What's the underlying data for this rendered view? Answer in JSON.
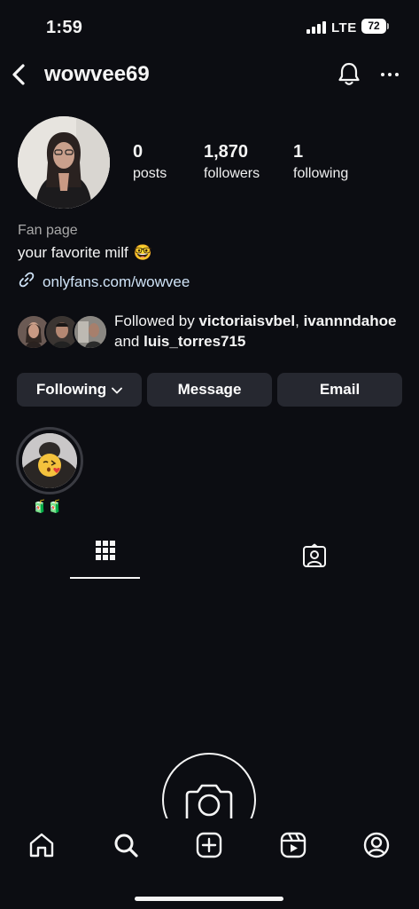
{
  "status_bar": {
    "time": "1:59",
    "network": "LTE",
    "battery": "72"
  },
  "header": {
    "username": "wowvee69",
    "icons": [
      "back-icon",
      "bell-icon",
      "more-icon"
    ]
  },
  "profile": {
    "stats": [
      {
        "value": "0",
        "label": "posts"
      },
      {
        "value": "1,870",
        "label": "followers"
      },
      {
        "value": "1",
        "label": "following"
      }
    ],
    "category": "Fan page",
    "bio": "your favorite milf",
    "bio_emoji": "🤓",
    "link": "onlyfans.com/wowvee"
  },
  "followed_by": {
    "prefix": "Followed by ",
    "user1": "victoriaisvbel",
    "sep1": ",",
    "user2": "ivannndahoe",
    "and": " and ",
    "user3": "luis_torres715"
  },
  "actions": {
    "following": "Following",
    "message": "Message",
    "email": "Email"
  },
  "highlight": {
    "label": "🧃🧃"
  },
  "tabs": [
    "grid-icon",
    "tagged-icon"
  ],
  "bottom_nav": [
    "home-icon",
    "search-icon",
    "create-icon",
    "reels-icon",
    "profile-icon"
  ],
  "colors": {
    "background": "#0c0d12",
    "button": "#262830",
    "link": "#cfe3f7",
    "secondary_text": "#a8a8a8"
  }
}
